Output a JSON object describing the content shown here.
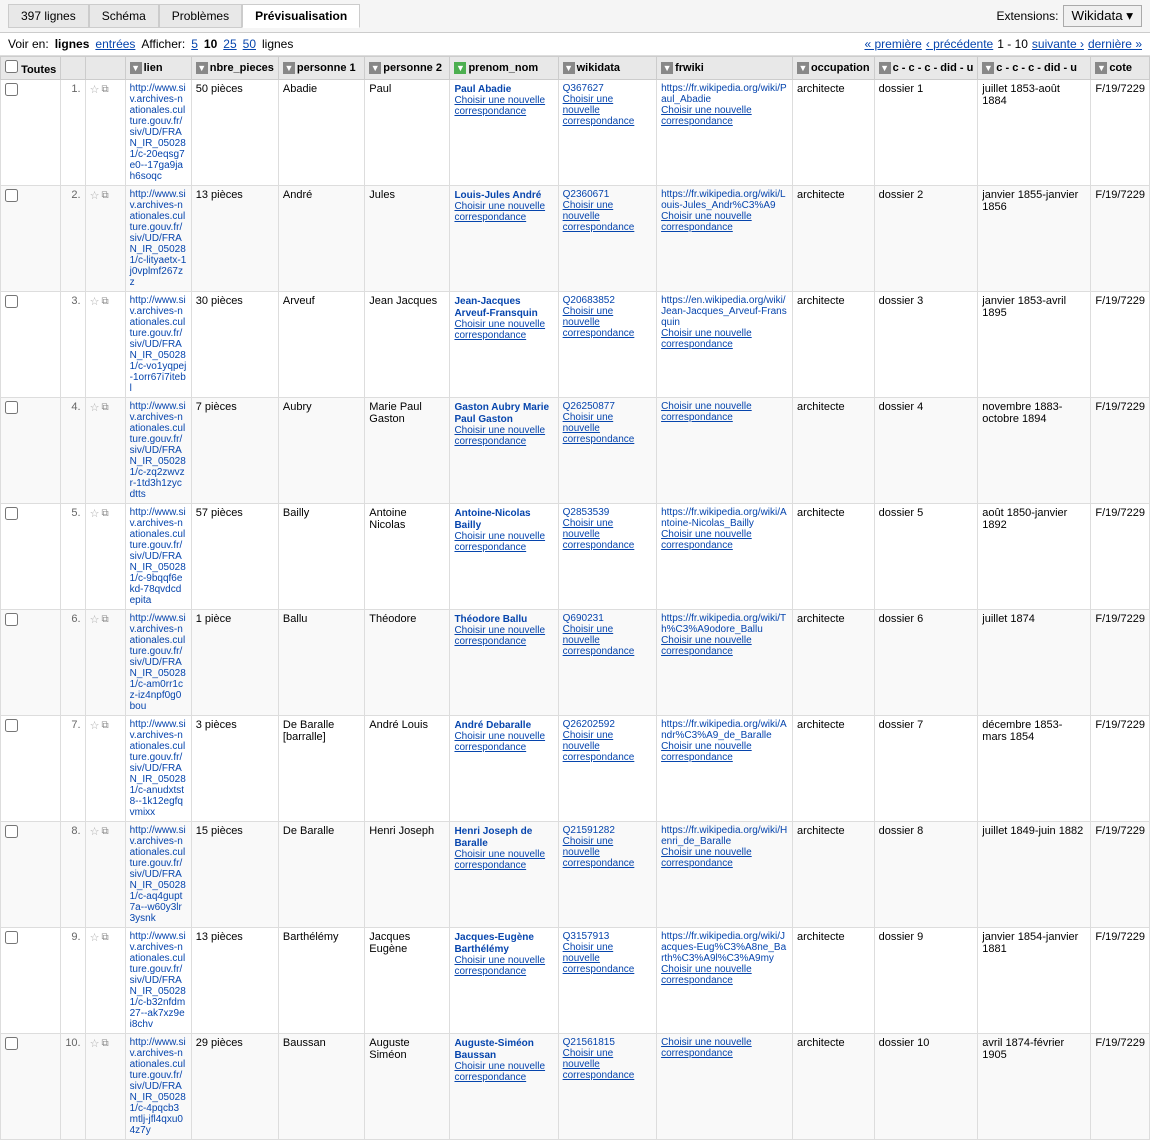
{
  "tabs": [
    {
      "label": "397 lignes",
      "active": false
    },
    {
      "label": "Schéma",
      "active": false
    },
    {
      "label": "Problèmes",
      "active": false
    },
    {
      "label": "Prévisualisation",
      "active": true
    }
  ],
  "extensions": {
    "label": "Extensions:",
    "button_label": "Wikidata ▾"
  },
  "controls": {
    "voir_en": "Voir en:",
    "lignes_label": "lignes",
    "entrees_label": "entrées",
    "afficher_label": "Afficher:",
    "counts": [
      "5",
      "10",
      "25",
      "50"
    ],
    "active_count": "10",
    "lignes_suffix": "lignes",
    "pagination": {
      "first": "« première",
      "prev": "‹ précédente",
      "current": "1 - 10",
      "next": "suivante ›",
      "last": "dernière »"
    }
  },
  "columns": [
    {
      "label": "",
      "type": "checkbox"
    },
    {
      "label": "",
      "type": "num"
    },
    {
      "label": "",
      "type": "icons"
    },
    {
      "label": "lien",
      "filter": true
    },
    {
      "label": "nbre_pieces",
      "filter": true
    },
    {
      "label": "personne 1",
      "filter": true
    },
    {
      "label": "personne 2",
      "filter": true
    },
    {
      "label": "prenom_nom",
      "filter": true,
      "green": true
    },
    {
      "label": "wikidata",
      "filter": true
    },
    {
      "label": "frwiki",
      "filter": true
    },
    {
      "label": "occupation",
      "filter": true
    },
    {
      "label": "c - c - c - did - u",
      "filter": true
    },
    {
      "label": "c - c - c - did - u",
      "filter": true
    },
    {
      "label": "cote",
      "filter": true
    }
  ],
  "rows": [
    {
      "num": "1.",
      "lien": "http://www.siv.archives-nationales.culture.gouv.fr/siv/UD/FRAN_IR_050281/c-20eqsg7e0--17ga9jah6soqc",
      "nbre_pieces": "50 pièces",
      "personne1": "Abadie",
      "personne2": "Paul",
      "prenom_nom_main": "Paul Abadie",
      "prenom_nom_sub": "Choisir une nouvelle correspondance",
      "wikidata": "Q367627",
      "wikidata_sub": "Choisir une nouvelle correspondance",
      "frwiki": "https://fr.wikipedia.org/wiki/Paul_Abadie",
      "frwiki_sub": "Choisir une nouvelle correspondance",
      "occupation": "architecte",
      "col12": "dossier 1",
      "col13": "juillet 1853-août 1884",
      "cote": "F/19/7229"
    },
    {
      "num": "2.",
      "lien": "http://www.siv.archives-nationales.culture.gouv.fr/siv/UD/FRAN_IR_050281/c-lityaetx-1j0vplmf267zz",
      "nbre_pieces": "13 pièces",
      "personne1": "André",
      "personne2": "Jules",
      "prenom_nom_main": "Louis-Jules André",
      "prenom_nom_sub": "Choisir une nouvelle correspondance",
      "wikidata": "Q2360671",
      "wikidata_sub": "Choisir une nouvelle correspondance",
      "frwiki": "https://fr.wikipedia.org/wiki/Louis-Jules_Andr%C3%A9",
      "frwiki_sub": "Choisir une nouvelle correspondance",
      "occupation": "architecte",
      "col12": "dossier 2",
      "col13": "janvier 1855-janvier 1856",
      "cote": "F/19/7229"
    },
    {
      "num": "3.",
      "lien": "http://www.siv.archives-nationales.culture.gouv.fr/siv/UD/FRAN_IR_050281/c-vo1yqpej-1orr67i7itebl",
      "nbre_pieces": "30 pièces",
      "personne1": "Arveuf",
      "personne2": "Jean Jacques",
      "prenom_nom_main": "Jean-Jacques Arveuf-Fransquin",
      "prenom_nom_sub": "Choisir une nouvelle correspondance",
      "wikidata": "Q20683852",
      "wikidata_sub": "Choisir une nouvelle correspondance",
      "frwiki": "https://en.wikipedia.org/wiki/Jean-Jacques_Arveuf-Fransquin",
      "frwiki_sub": "Choisir une nouvelle correspondance",
      "occupation": "architecte",
      "col12": "dossier 3",
      "col13": "janvier 1853-avril 1895",
      "cote": "F/19/7229"
    },
    {
      "num": "4.",
      "lien": "http://www.siv.archives-nationales.culture.gouv.fr/siv/UD/FRAN_IR_050281/c-zq2zwvzr-1td3h1zycdtts",
      "nbre_pieces": "7 pièces",
      "personne1": "Aubry",
      "personne2": "Marie Paul Gaston",
      "prenom_nom_main": "Gaston Aubry Marie Paul Gaston",
      "prenom_nom_sub": "Choisir une nouvelle correspondance",
      "wikidata": "Q26250877",
      "wikidata_sub": "Choisir une nouvelle correspondance",
      "frwiki": "",
      "frwiki_sub": "Choisir une nouvelle correspondance",
      "occupation": "architecte",
      "col12": "dossier 4",
      "col13": "novembre 1883-octobre 1894",
      "cote": "F/19/7229"
    },
    {
      "num": "5.",
      "lien": "http://www.siv.archives-nationales.culture.gouv.fr/siv/UD/FRAN_IR_050281/c-9bqqf6ekd-78qvdcdepita",
      "nbre_pieces": "57 pièces",
      "personne1": "Bailly",
      "personne2": "Antoine Nicolas",
      "prenom_nom_main": "Antoine-Nicolas Bailly",
      "prenom_nom_sub": "Choisir une nouvelle correspondance",
      "wikidata": "Q2853539",
      "wikidata_sub": "Choisir une nouvelle correspondance",
      "frwiki": "https://fr.wikipedia.org/wiki/Antoine-Nicolas_Bailly",
      "frwiki_sub": "Choisir une nouvelle correspondance",
      "occupation": "architecte",
      "col12": "dossier 5",
      "col13": "août 1850-janvier 1892",
      "cote": "F/19/7229"
    },
    {
      "num": "6.",
      "lien": "http://www.siv.archives-nationales.culture.gouv.fr/siv/UD/FRAN_IR_050281/c-am0rr1cz-iz4npf0g0bou",
      "nbre_pieces": "1 pièce",
      "personne1": "Ballu",
      "personne2": "Théodore",
      "prenom_nom_main": "Théodore Ballu",
      "prenom_nom_sub": "Choisir une nouvelle correspondance",
      "wikidata": "Q690231",
      "wikidata_sub": "Choisir une nouvelle correspondance",
      "frwiki": "https://fr.wikipedia.org/wiki/Th%C3%A9odore_Ballu",
      "frwiki_sub": "Choisir une nouvelle correspondance",
      "occupation": "architecte",
      "col12": "dossier 6",
      "col13": "juillet 1874",
      "cote": "F/19/7229"
    },
    {
      "num": "7.",
      "lien": "http://www.siv.archives-nationales.culture.gouv.fr/siv/UD/FRAN_IR_050281/c-anudxtst8--1k12egfqvmixx",
      "nbre_pieces": "3 pièces",
      "personne1": "De Baralle [barralle]",
      "personne2": "André Louis",
      "prenom_nom_main": "André Debaralle",
      "prenom_nom_sub": "Choisir une nouvelle correspondance",
      "wikidata": "Q26202592",
      "wikidata_sub": "Choisir une nouvelle correspondance",
      "frwiki": "https://fr.wikipedia.org/wiki/Andr%C3%A9_de_Baralle",
      "frwiki_sub": "Choisir une nouvelle correspondance",
      "occupation": "architecte",
      "col12": "dossier 7",
      "col13": "décembre 1853-mars 1854",
      "cote": "F/19/7229"
    },
    {
      "num": "8.",
      "lien": "http://www.siv.archives-nationales.culture.gouv.fr/siv/UD/FRAN_IR_050281/c-aq4gupt7a--w60y3lr3ysnk",
      "nbre_pieces": "15 pièces",
      "personne1": "De Baralle",
      "personne2": "Henri Joseph",
      "prenom_nom_main": "Henri Joseph de Baralle",
      "prenom_nom_sub": "Choisir une nouvelle correspondance",
      "wikidata": "Q21591282",
      "wikidata_sub": "Choisir une nouvelle correspondance",
      "frwiki": "https://fr.wikipedia.org/wiki/Henri_de_Baralle",
      "frwiki_sub": "Choisir une nouvelle correspondance",
      "occupation": "architecte",
      "col12": "dossier 8",
      "col13": "juillet 1849-juin 1882",
      "cote": "F/19/7229"
    },
    {
      "num": "9.",
      "lien": "http://www.siv.archives-nationales.culture.gouv.fr/siv/UD/FRAN_IR_050281/c-b32nfdm27--ak7xz9ei8chv",
      "nbre_pieces": "13 pièces",
      "personne1": "Barthélémy",
      "personne2": "Jacques Eugène",
      "prenom_nom_main": "Jacques-Eugène Barthélémy",
      "prenom_nom_sub": "Choisir une nouvelle correspondance",
      "wikidata": "Q3157913",
      "wikidata_sub": "Choisir une nouvelle correspondance",
      "frwiki": "https://fr.wikipedia.org/wiki/Jacques-Eug%C3%A8ne_Barth%C3%A9l%C3%A9my",
      "frwiki_sub": "Choisir une nouvelle correspondance",
      "occupation": "architecte",
      "col12": "dossier 9",
      "col13": "janvier 1854-janvier 1881",
      "cote": "F/19/7229"
    },
    {
      "num": "10.",
      "lien": "http://www.siv.archives-nationales.culture.gouv.fr/siv/UD/FRAN_IR_050281/c-4pqcb3mtlj-jfl4qxu04z7y",
      "nbre_pieces": "29 pièces",
      "personne1": "Baussan",
      "personne2": "Auguste Siméon",
      "prenom_nom_main": "Auguste-Siméon Baussan",
      "prenom_nom_sub": "Choisir une nouvelle correspondance",
      "wikidata": "Q21561815",
      "wikidata_sub": "Choisir une nouvelle correspondance",
      "frwiki": "",
      "frwiki_sub": "Choisir une nouvelle correspondance",
      "occupation": "architecte",
      "col12": "dossier 10",
      "col13": "avril 1874-février 1905",
      "cote": "F/19/7229"
    }
  ]
}
